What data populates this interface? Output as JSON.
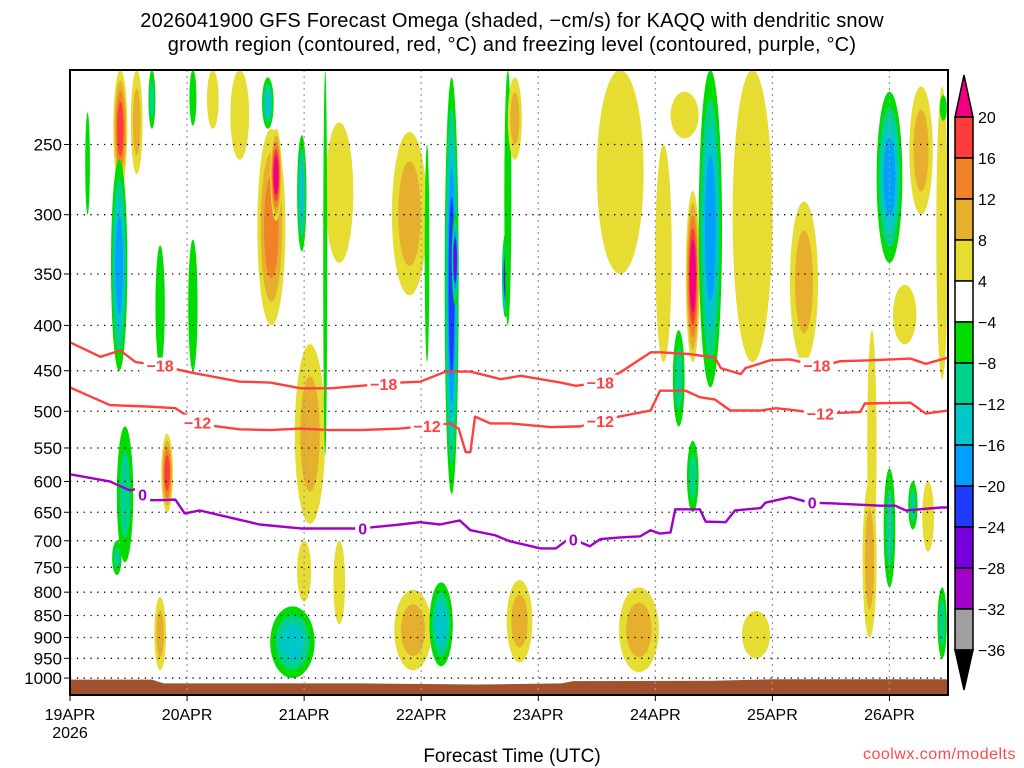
{
  "chart_data": {
    "type": "heatmap",
    "title_lines": [
      "2026041900 GFS Forecast Omega (shaded, −cm/s) for KAQQ with dendritic snow",
      "growth region (contoured, red, °C) and freezing level (contoured, purple, °C)"
    ],
    "xlabel": "Forecast Time (UTC)",
    "x_range_days": [
      0,
      7.5
    ],
    "x_ticks": [
      {
        "day": 0,
        "label": "19APR",
        "sublabel": "2026"
      },
      {
        "day": 1,
        "label": "20APR"
      },
      {
        "day": 2,
        "label": "21APR"
      },
      {
        "day": 3,
        "label": "22APR"
      },
      {
        "day": 4,
        "label": "23APR"
      },
      {
        "day": 5,
        "label": "24APR"
      },
      {
        "day": 6,
        "label": "25APR"
      },
      {
        "day": 7,
        "label": "26APR"
      }
    ],
    "y_scale": "log",
    "y_range_hPa": [
      1045,
      206
    ],
    "y_ticks": [
      "250",
      "300",
      "350",
      "400",
      "450",
      "500",
      "550",
      "600",
      "650",
      "700",
      "750",
      "800",
      "850",
      "900",
      "950",
      "1000"
    ],
    "colorbar": {
      "labels": [
        "20",
        "16",
        "12",
        "8",
        "4",
        "−4",
        "−8",
        "−12",
        "−16",
        "−20",
        "−24",
        "−28",
        "−32",
        "−36"
      ],
      "over_color": "#f0007f",
      "under_color": "#000000",
      "box_colors": [
        "#ff3c3c",
        "#f08228",
        "#e6af2d",
        "#e6dc32",
        "#ffffff",
        "#00dc00",
        "#00d28c",
        "#00c8c8",
        "#00a0ff",
        "#1e3cff",
        "#7800dc",
        "#a000c8",
        "#a0a0a0"
      ]
    },
    "shading_levels": {
      "positive": [
        [
          4,
          "#e6dc32"
        ],
        [
          8,
          "#e6af2d"
        ],
        [
          12,
          "#f08228"
        ],
        [
          16,
          "#ff3c3c"
        ],
        [
          20,
          "#f0007f"
        ]
      ],
      "negative": [
        [
          -4,
          "#00dc00"
        ],
        [
          -8,
          "#00d28c"
        ],
        [
          -12,
          "#00c8c8"
        ],
        [
          -16,
          "#00a0ff"
        ],
        [
          -20,
          "#1e3cff"
        ],
        [
          -24,
          "#7800dc"
        ],
        [
          -28,
          "#a000c8"
        ]
      ]
    },
    "omega_features_day_ptop_pbot_halfwidth_value": [
      [
        0.43,
        206,
        280,
        0.06,
        18
      ],
      [
        0.57,
        206,
        270,
        0.05,
        10
      ],
      [
        0.7,
        206,
        240,
        0.03,
        -10
      ],
      [
        0.42,
        260,
        450,
        0.07,
        -18
      ],
      [
        0.77,
        325,
        445,
        0.04,
        -7
      ],
      [
        1.05,
        206,
        238,
        0.03,
        -7
      ],
      [
        1.05,
        320,
        450,
        0.04,
        -7
      ],
      [
        1.22,
        206,
        240,
        0.05,
        6
      ],
      [
        1.45,
        206,
        260,
        0.08,
        6
      ],
      [
        1.72,
        240,
        400,
        0.12,
        12
      ],
      [
        1.76,
        240,
        305,
        0.05,
        22
      ],
      [
        1.69,
        210,
        240,
        0.05,
        -12
      ],
      [
        1.98,
        244,
        330,
        0.04,
        -14
      ],
      [
        2.3,
        236,
        340,
        0.12,
        6
      ],
      [
        2.9,
        242,
        370,
        0.15,
        10
      ],
      [
        3.26,
        210,
        620,
        0.06,
        -22
      ],
      [
        3.29,
        300,
        380,
        0.03,
        -26
      ],
      [
        3.72,
        315,
        392,
        0.03,
        -24
      ],
      [
        3.74,
        206,
        400,
        0.03,
        -6
      ],
      [
        3.8,
        210,
        260,
        0.06,
        10
      ],
      [
        4.7,
        206,
        350,
        0.2,
        6
      ],
      [
        5.25,
        218,
        246,
        0.12,
        5
      ],
      [
        5.07,
        250,
        440,
        0.07,
        5
      ],
      [
        5.32,
        282,
        440,
        0.06,
        21
      ],
      [
        5.47,
        206,
        470,
        0.1,
        -18
      ],
      [
        5.83,
        206,
        440,
        0.17,
        6
      ],
      [
        6.27,
        290,
        440,
        0.12,
        9
      ],
      [
        7.0,
        218,
        340,
        0.11,
        -18
      ],
      [
        7.27,
        215,
        300,
        0.1,
        11
      ],
      [
        7.13,
        360,
        420,
        0.1,
        5
      ],
      [
        7.45,
        215,
        460,
        0.05,
        6
      ],
      [
        7.46,
        220,
        235,
        0.03,
        -6
      ],
      [
        0.83,
        530,
        650,
        0.05,
        17
      ],
      [
        0.47,
        520,
        740,
        0.07,
        -8
      ],
      [
        2.05,
        420,
        670,
        0.13,
        9
      ],
      [
        5.2,
        405,
        520,
        0.05,
        -8
      ],
      [
        5.32,
        540,
        650,
        0.05,
        -8
      ],
      [
        6.85,
        405,
        740,
        0.04,
        5
      ],
      [
        7.0,
        580,
        790,
        0.05,
        -8
      ],
      [
        7.2,
        600,
        680,
        0.04,
        -8
      ],
      [
        7.33,
        600,
        720,
        0.05,
        5
      ],
      [
        1.9,
        830,
        1000,
        0.19,
        -15
      ],
      [
        2.93,
        795,
        980,
        0.16,
        11
      ],
      [
        3.17,
        780,
        970,
        0.1,
        -12
      ],
      [
        3.84,
        775,
        960,
        0.11,
        10
      ],
      [
        4.86,
        790,
        985,
        0.17,
        11
      ],
      [
        5.86,
        840,
        950,
        0.12,
        6
      ],
      [
        6.83,
        600,
        900,
        0.06,
        10
      ],
      [
        7.45,
        790,
        950,
        0.04,
        -8
      ],
      [
        0.77,
        810,
        980,
        0.05,
        8
      ],
      [
        2.0,
        700,
        820,
        0.06,
        6
      ],
      [
        2.3,
        700,
        870,
        0.05,
        5
      ],
      [
        0.4,
        700,
        765,
        0.04,
        -8
      ],
      [
        2.18,
        206,
        560,
        0.015,
        -6
      ],
      [
        3.05,
        250,
        440,
        0.02,
        -6
      ],
      [
        0.15,
        230,
        300,
        0.02,
        -6
      ]
    ],
    "contours": [
      {
        "label": "−18",
        "color": "#ff4040",
        "label_days": [
          0.77,
          2.68,
          4.53,
          6.38
        ],
        "points": [
          [
            0,
            418
          ],
          [
            0.26,
            434
          ],
          [
            0.43,
            427
          ],
          [
            0.56,
            440
          ],
          [
            0.77,
            444
          ],
          [
            1.03,
            452
          ],
          [
            1.45,
            463
          ],
          [
            1.71,
            464
          ],
          [
            1.97,
            471
          ],
          [
            2.22,
            471
          ],
          [
            2.48,
            468
          ],
          [
            2.82,
            464
          ],
          [
            2.99,
            463
          ],
          [
            3.21,
            451
          ],
          [
            3.42,
            451
          ],
          [
            3.68,
            460
          ],
          [
            3.85,
            456
          ],
          [
            4.19,
            464
          ],
          [
            4.32,
            468
          ],
          [
            4.53,
            464
          ],
          [
            4.7,
            452
          ],
          [
            4.96,
            429
          ],
          [
            5.04,
            429
          ],
          [
            5.3,
            431
          ],
          [
            5.51,
            435
          ],
          [
            5.56,
            447
          ],
          [
            5.73,
            454
          ],
          [
            5.77,
            447
          ],
          [
            5.98,
            438
          ],
          [
            6.15,
            437
          ],
          [
            6.41,
            445
          ],
          [
            6.58,
            439
          ],
          [
            6.84,
            438
          ],
          [
            7.18,
            436
          ],
          [
            7.31,
            442
          ],
          [
            7.5,
            435
          ]
        ]
      },
      {
        "label": "−12",
        "color": "#ff4040",
        "label_days": [
          1.09,
          3.05,
          4.53,
          6.41
        ],
        "points": [
          [
            0,
            470
          ],
          [
            0.34,
            492
          ],
          [
            0.68,
            494
          ],
          [
            0.9,
            496
          ],
          [
            1.11,
            517
          ],
          [
            1.45,
            524
          ],
          [
            1.71,
            525
          ],
          [
            1.97,
            523
          ],
          [
            2.22,
            525
          ],
          [
            2.48,
            525
          ],
          [
            2.82,
            523
          ],
          [
            3.25,
            516
          ],
          [
            3.32,
            523
          ],
          [
            3.38,
            556
          ],
          [
            3.42,
            556
          ],
          [
            3.46,
            507
          ],
          [
            3.59,
            516
          ],
          [
            3.76,
            516
          ],
          [
            4.1,
            521
          ],
          [
            4.36,
            520
          ],
          [
            4.62,
            509
          ],
          [
            4.96,
            499
          ],
          [
            5.04,
            474
          ],
          [
            5.26,
            474
          ],
          [
            5.38,
            482
          ],
          [
            5.51,
            485
          ],
          [
            5.64,
            499
          ],
          [
            5.9,
            499
          ],
          [
            6.03,
            496
          ],
          [
            6.15,
            498
          ],
          [
            6.41,
            503
          ],
          [
            6.75,
            501
          ],
          [
            6.79,
            490
          ],
          [
            7.18,
            489
          ],
          [
            7.31,
            503
          ],
          [
            7.5,
            499
          ]
        ]
      },
      {
        "label": "0",
        "color": "#a000c8",
        "label_days": [
          0.62,
          2.5,
          4.3,
          6.34
        ],
        "points": [
          [
            0,
            589
          ],
          [
            0.34,
            600
          ],
          [
            0.51,
            614
          ],
          [
            0.6,
            611
          ],
          [
            0.64,
            630
          ],
          [
            0.77,
            630
          ],
          [
            0.9,
            629
          ],
          [
            0.98,
            652
          ],
          [
            1.11,
            647
          ],
          [
            1.28,
            655
          ],
          [
            1.62,
            671
          ],
          [
            1.97,
            678
          ],
          [
            2.48,
            678
          ],
          [
            2.82,
            671
          ],
          [
            2.99,
            667
          ],
          [
            3.16,
            671
          ],
          [
            3.33,
            664
          ],
          [
            3.42,
            681
          ],
          [
            3.63,
            690
          ],
          [
            3.76,
            701
          ],
          [
            4.02,
            714
          ],
          [
            4.15,
            714
          ],
          [
            4.27,
            695
          ],
          [
            4.44,
            710
          ],
          [
            4.53,
            697
          ],
          [
            4.7,
            694
          ],
          [
            4.87,
            692
          ],
          [
            4.96,
            681
          ],
          [
            5.04,
            687
          ],
          [
            5.13,
            685
          ],
          [
            5.17,
            645
          ],
          [
            5.38,
            645
          ],
          [
            5.43,
            666
          ],
          [
            5.6,
            667
          ],
          [
            5.68,
            647
          ],
          [
            5.9,
            643
          ],
          [
            5.94,
            634
          ],
          [
            6.15,
            625
          ],
          [
            6.32,
            634
          ],
          [
            6.5,
            635
          ],
          [
            6.92,
            639
          ],
          [
            7.05,
            639
          ],
          [
            7.14,
            647
          ],
          [
            7.44,
            642
          ],
          [
            7.5,
            642
          ]
        ]
      }
    ],
    "surface_hPa": [
      [
        0,
        1004
      ],
      [
        0.7,
        1004
      ],
      [
        0.8,
        1014
      ],
      [
        2.0,
        1014
      ],
      [
        2.5,
        1014
      ],
      [
        3.5,
        1017
      ],
      [
        4.2,
        1014
      ],
      [
        4.3,
        1008
      ],
      [
        5.5,
        1007
      ],
      [
        6.0,
        1003
      ],
      [
        6.8,
        1003
      ],
      [
        7.5,
        1003
      ]
    ],
    "terrain_color": "#a0522d"
  },
  "credit": "coolwx.com/modelts"
}
